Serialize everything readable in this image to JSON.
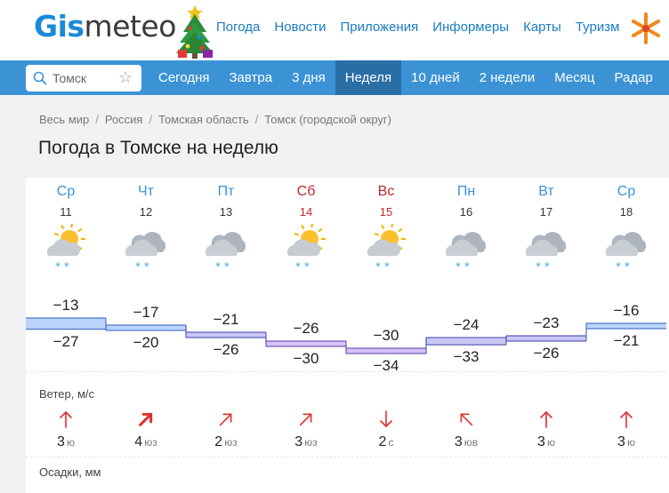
{
  "brand": {
    "part1": "Gis",
    "part2": "meteo"
  },
  "topnav": [
    "Погода",
    "Новости",
    "Приложения",
    "Информеры",
    "Карты",
    "Туризм"
  ],
  "search": {
    "value": "Томск"
  },
  "tabs": [
    {
      "label": "Сегодня",
      "active": false
    },
    {
      "label": "Завтра",
      "active": false
    },
    {
      "label": "3 дня",
      "active": false
    },
    {
      "label": "Неделя",
      "active": true
    },
    {
      "label": "10 дней",
      "active": false
    },
    {
      "label": "2 недели",
      "active": false
    },
    {
      "label": "Месяц",
      "active": false
    },
    {
      "label": "Радар",
      "active": false
    }
  ],
  "breadcrumb": [
    "Весь мир",
    "Россия",
    "Томская область",
    "Томск (городской округ)"
  ],
  "title": "Погода в Томске на неделю",
  "colors": {
    "accent": "#3b93d6",
    "weekend": "#c0282e",
    "wind_arrow": "#e0302a"
  },
  "days": [
    {
      "dow": "Ср",
      "date": "11",
      "weekend": false,
      "icon": "sun-cloud-snow",
      "max": "−13",
      "min": "−27",
      "max_v": -13,
      "min_v": -27,
      "wind": "3",
      "wind_dir": "ю",
      "arrow": "up",
      "strong": false
    },
    {
      "dow": "Чт",
      "date": "12",
      "weekend": false,
      "icon": "cloud-snow",
      "max": "−17",
      "min": "−20",
      "max_v": -17,
      "min_v": -20,
      "wind": "4",
      "wind_dir": "юз",
      "arrow": "up-right",
      "strong": true
    },
    {
      "dow": "Пт",
      "date": "13",
      "weekend": false,
      "icon": "cloud-snow",
      "max": "−21",
      "min": "−26",
      "max_v": -21,
      "min_v": -26,
      "wind": "2",
      "wind_dir": "юз",
      "arrow": "up-right",
      "strong": false
    },
    {
      "dow": "Сб",
      "date": "14",
      "weekend": true,
      "icon": "sun-cloud-snow",
      "max": "−26",
      "min": "−30",
      "max_v": -26,
      "min_v": -30,
      "wind": "3",
      "wind_dir": "юз",
      "arrow": "up-right",
      "strong": false
    },
    {
      "dow": "Вс",
      "date": "15",
      "weekend": true,
      "icon": "sun-cloud-snow",
      "max": "−30",
      "min": "−34",
      "max_v": -30,
      "min_v": -34,
      "wind": "2",
      "wind_dir": "с",
      "arrow": "down",
      "strong": false
    },
    {
      "dow": "Пн",
      "date": "16",
      "weekend": false,
      "icon": "cloud-snow",
      "max": "−24",
      "min": "−33",
      "max_v": -24,
      "min_v": -33,
      "wind": "3",
      "wind_dir": "юв",
      "arrow": "up-left",
      "strong": false
    },
    {
      "dow": "Вт",
      "date": "17",
      "weekend": false,
      "icon": "cloud-snow",
      "max": "−23",
      "min": "−26",
      "max_v": -23,
      "min_v": -26,
      "wind": "3",
      "wind_dir": "ю",
      "arrow": "up",
      "strong": false
    },
    {
      "dow": "Ср",
      "date": "18",
      "weekend": false,
      "icon": "cloud-snow",
      "max": "−16",
      "min": "−21",
      "max_v": -16,
      "min_v": -21,
      "wind": "3",
      "wind_dir": "ю",
      "arrow": "up",
      "strong": false
    }
  ],
  "wind_label": "Ветер, м/с",
  "precip_label": "Осадки, мм"
}
